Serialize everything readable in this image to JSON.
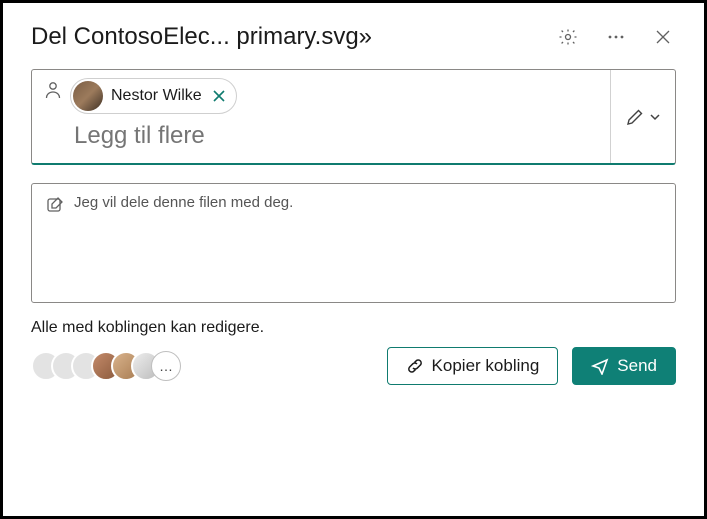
{
  "header": {
    "title": "Del ContosoElec... primary.svg»"
  },
  "recipients": {
    "chip": {
      "name": "Nestor Wilke"
    },
    "add_more_placeholder": "Legg til flere"
  },
  "message": {
    "text": "Jeg vil dele denne filen med deg."
  },
  "footer": {
    "link_info": "Alle med koblingen kan redigere.",
    "more_label": "…",
    "copy_label": "Kopier kobling",
    "send_label": "Send"
  },
  "colors": {
    "accent": "#0f8076"
  }
}
